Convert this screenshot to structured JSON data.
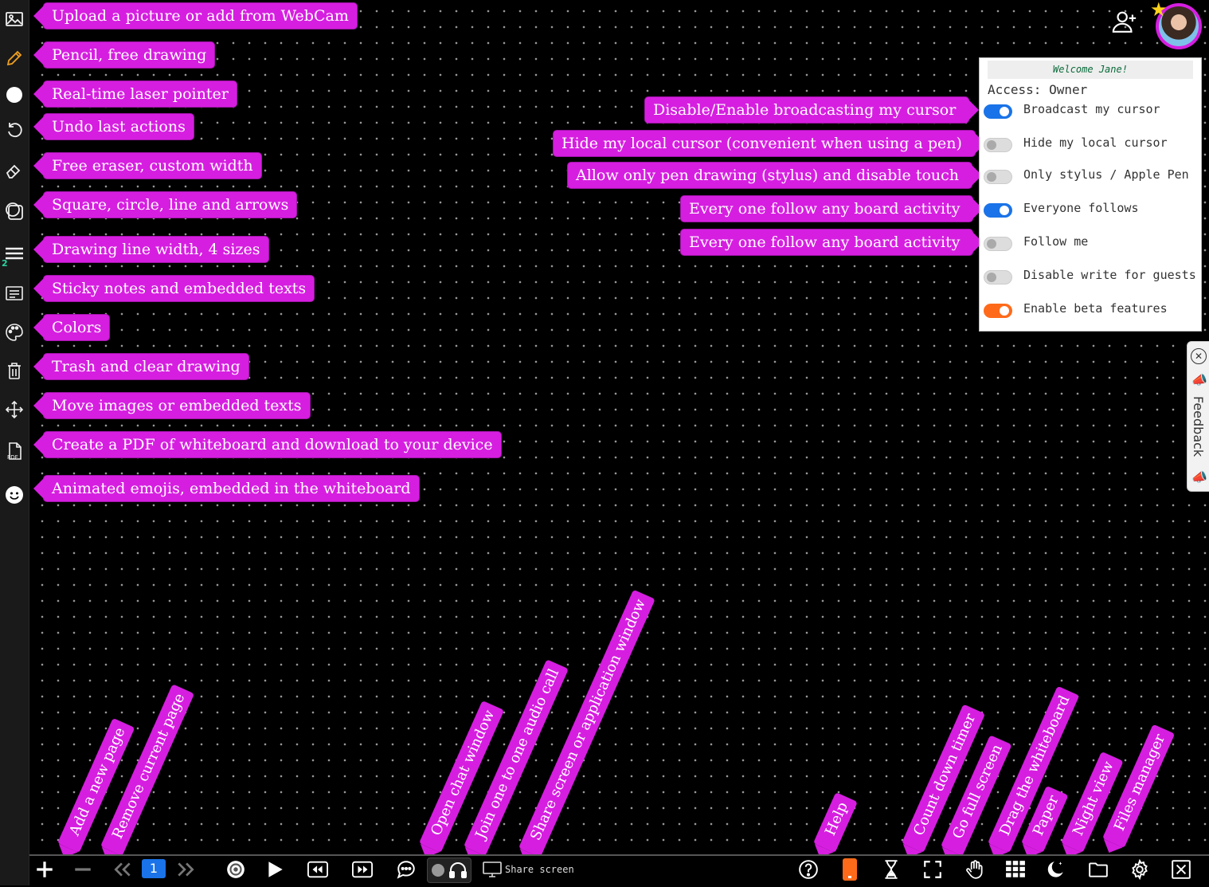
{
  "sidebar_tips": [
    {
      "id": "upload",
      "label": "Upload a picture or add from WebCam"
    },
    {
      "id": "pencil",
      "label": "Pencil, free drawing"
    },
    {
      "id": "laser",
      "label": "Real-time laser pointer"
    },
    {
      "id": "undo",
      "label": "Undo last actions"
    },
    {
      "id": "eraser",
      "label": "Free eraser, custom width"
    },
    {
      "id": "shapes",
      "label": "Square, circle, line and arrows"
    },
    {
      "id": "width",
      "label": "Drawing line width, 4 sizes"
    },
    {
      "id": "notes",
      "label": "Sticky notes and embedded texts"
    },
    {
      "id": "colors",
      "label": "Colors"
    },
    {
      "id": "trash",
      "label": "Trash and clear drawing"
    },
    {
      "id": "move",
      "label": "Move images or embedded texts"
    },
    {
      "id": "pdf",
      "label": "Create a PDF of whiteboard and download to your device"
    },
    {
      "id": "emoji",
      "label": "Animated emojis, embedded in the whiteboard"
    }
  ],
  "sidebar": {
    "width_badge": "2",
    "pdf_label": "PDF"
  },
  "panel_tips": [
    "Disable/Enable broadcasting my cursor",
    "Hide my local cursor (convenient when using a pen)",
    "Allow only pen drawing (stylus) and disable touch",
    "Every one follow any board activity",
    "Every one follow any board activity"
  ],
  "settings_panel": {
    "welcome": "Welcome Jane!",
    "access": "Access: Owner",
    "options": [
      {
        "label": "Broadcast my cursor",
        "state": "on",
        "color": "#1a73e8"
      },
      {
        "label": "Hide my local cursor",
        "state": "off"
      },
      {
        "label": "Only stylus / Apple Pen",
        "state": "off"
      },
      {
        "label": "Everyone follows",
        "state": "on",
        "color": "#1a73e8"
      },
      {
        "label": "Follow me",
        "state": "off"
      },
      {
        "label": "Disable write for guests",
        "state": "off"
      },
      {
        "label": "Enable beta features",
        "state": "on",
        "color": "#ff6a1a"
      }
    ]
  },
  "bottom_tips": {
    "add_page": "Add a new page",
    "remove_page": "Remove current page",
    "chat": "Open chat window",
    "audio": "Join one to one audio call",
    "share": "Share screen or application window",
    "help": "Help",
    "timer": "Count down timer",
    "fullscreen": "Go full screen",
    "drag": "Drag the whiteboard",
    "paper": "Paper",
    "night": "Night view",
    "files": "Files manager"
  },
  "bottombar": {
    "page_number": "1",
    "share_label": "Share screen"
  },
  "feedback": {
    "label": "Feedback"
  },
  "colors": {
    "accent": "#d61ee0",
    "toggle_blue": "#1a73e8",
    "toggle_orange": "#ff6a1a",
    "timer_orange": "#ff6a1a"
  }
}
